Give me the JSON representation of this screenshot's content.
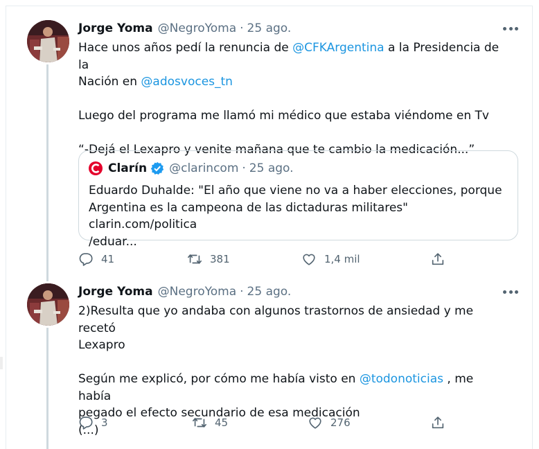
{
  "tweets": [
    {
      "author": "Jorge Yoma",
      "handle": "@NegroYoma",
      "separator": "·",
      "date": "25 ago.",
      "line1_pre": "Hace unos años pedí la renuncia de ",
      "mention1": "@CFKArgentina",
      "line1_post": " a la Presidencia de la",
      "line2_pre": "Nación en ",
      "mention2": "@adosvoces_tn",
      "para2": "Luego del programa me llamó mi médico que estaba viéndome en Tv",
      "para3": "“-Dejá el Lexapro y venite mañana que te cambio la medicación...”",
      "quote": {
        "name": "Clarín",
        "handle": "@clarincom",
        "separator": "·",
        "date": "25 ago.",
        "line1": "Eduardo Duhalde: \"El año que viene no va a haber elecciones, porque",
        "line2": "Argentina es la campeona de las dictaduras militares\" clarin.com/politica",
        "line3": "/eduar..."
      },
      "replies": "41",
      "retweets": "381",
      "likes": "1,4 mil"
    },
    {
      "author": "Jorge Yoma",
      "handle": "@NegroYoma",
      "separator": "·",
      "date": "25 ago.",
      "line1": "2)Resulta que yo andaba con algunos trastornos de ansiedad y me recetó",
      "line2": "Lexapro",
      "line3_pre": "Según me explicó, por cómo me había visto en ",
      "mention": "@todonoticias",
      "line3_post": " , me había",
      "line4": "pegado el efecto secundario de esa medicación",
      "line5": "(...)",
      "replies": "3",
      "retweets": "45",
      "likes": "276"
    }
  ],
  "colors": {
    "link": "#1b95e0",
    "secondary_text": "#5b7083",
    "thread_line": "#cfd9de",
    "clarin_red": "#e4002b",
    "verified_blue": "#1d9bf0"
  },
  "icons": [
    "more-icon",
    "reply-icon",
    "retweet-icon",
    "like-icon",
    "share-icon",
    "verified-icon",
    "clarin-logo"
  ]
}
